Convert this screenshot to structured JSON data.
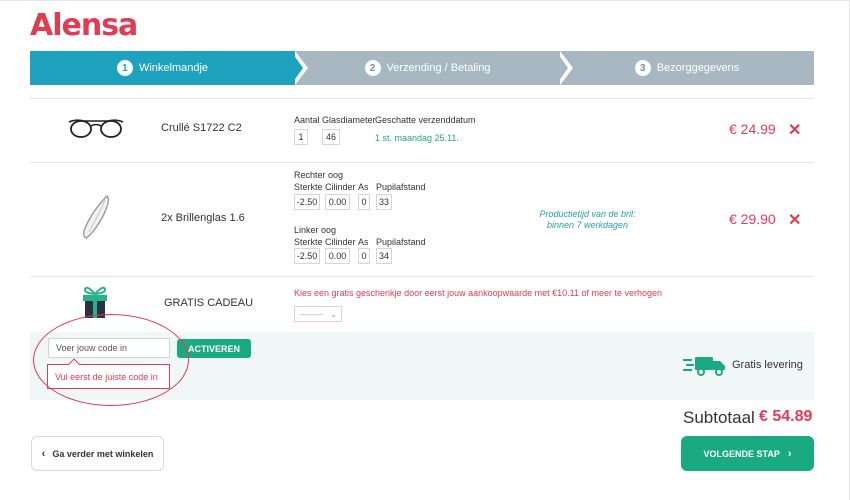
{
  "brand": {
    "name": "Alensa",
    "color": "#e03c52"
  },
  "steps": [
    {
      "num": "1",
      "label": "Winkelmandje",
      "active": true
    },
    {
      "num": "2",
      "label": "Verzending / Betaling",
      "active": false
    },
    {
      "num": "3",
      "label": "Bezorggegevens",
      "active": false
    }
  ],
  "items": [
    {
      "name": "Crullé S1722 C2",
      "icon": "eyeglasses-icon",
      "headers": {
        "quantity": "Aantal",
        "diameter": "Glasdiameter",
        "delivery": "Geschatte verzenddatum"
      },
      "quantity": "1",
      "diameter": "46",
      "delivery_date": "1 st. maandag 25.11.",
      "price": "€ 24.99"
    },
    {
      "name": "2x Brillenglas 1.6",
      "icon": "lens-icon",
      "right_eye": {
        "title": "Rechter oog",
        "sterkte": "-2.50",
        "cilinder": "0.00",
        "as": "0",
        "pupil": "33"
      },
      "left_eye": {
        "title": "Linker oog",
        "sterkte": "-2.50",
        "cilinder": "0.00",
        "as": "0",
        "pupil": "34"
      },
      "headers": {
        "sterkte": "Sterkte",
        "cilinder": "Cilinder",
        "as": "As",
        "pupil": "Pupilafstand"
      },
      "production_note_1": "Productietijd van de bril:",
      "production_note_2": "binnen 7 werkdagen",
      "price": "€ 29.90"
    }
  ],
  "gift": {
    "title": "GRATIS CADEAU",
    "icon": "gift-icon",
    "message": "Kies een gratis geschenkje door eerst jouw aankoopwaarde met €10.11 of meer te verhogen",
    "select_value": "———"
  },
  "coupon": {
    "placeholder": "Voer jouw code in",
    "button": "ACTIVEREN",
    "error": "Vul eerst de juiste code in"
  },
  "delivery": {
    "icon": "truck-icon",
    "label": "Gratis levering"
  },
  "subtotal": {
    "label": "Subtotaal",
    "amount": "€ 54.89"
  },
  "actions": {
    "back": "Ga verder met winkelen",
    "next": "VOLGENDE STAP"
  },
  "colors": {
    "teal": "#1ea3bf",
    "green": "#1aaa82",
    "step_inactive": "#a8b8c3",
    "gift_green": "#27b38a",
    "gift_dark": "#2b3142"
  }
}
